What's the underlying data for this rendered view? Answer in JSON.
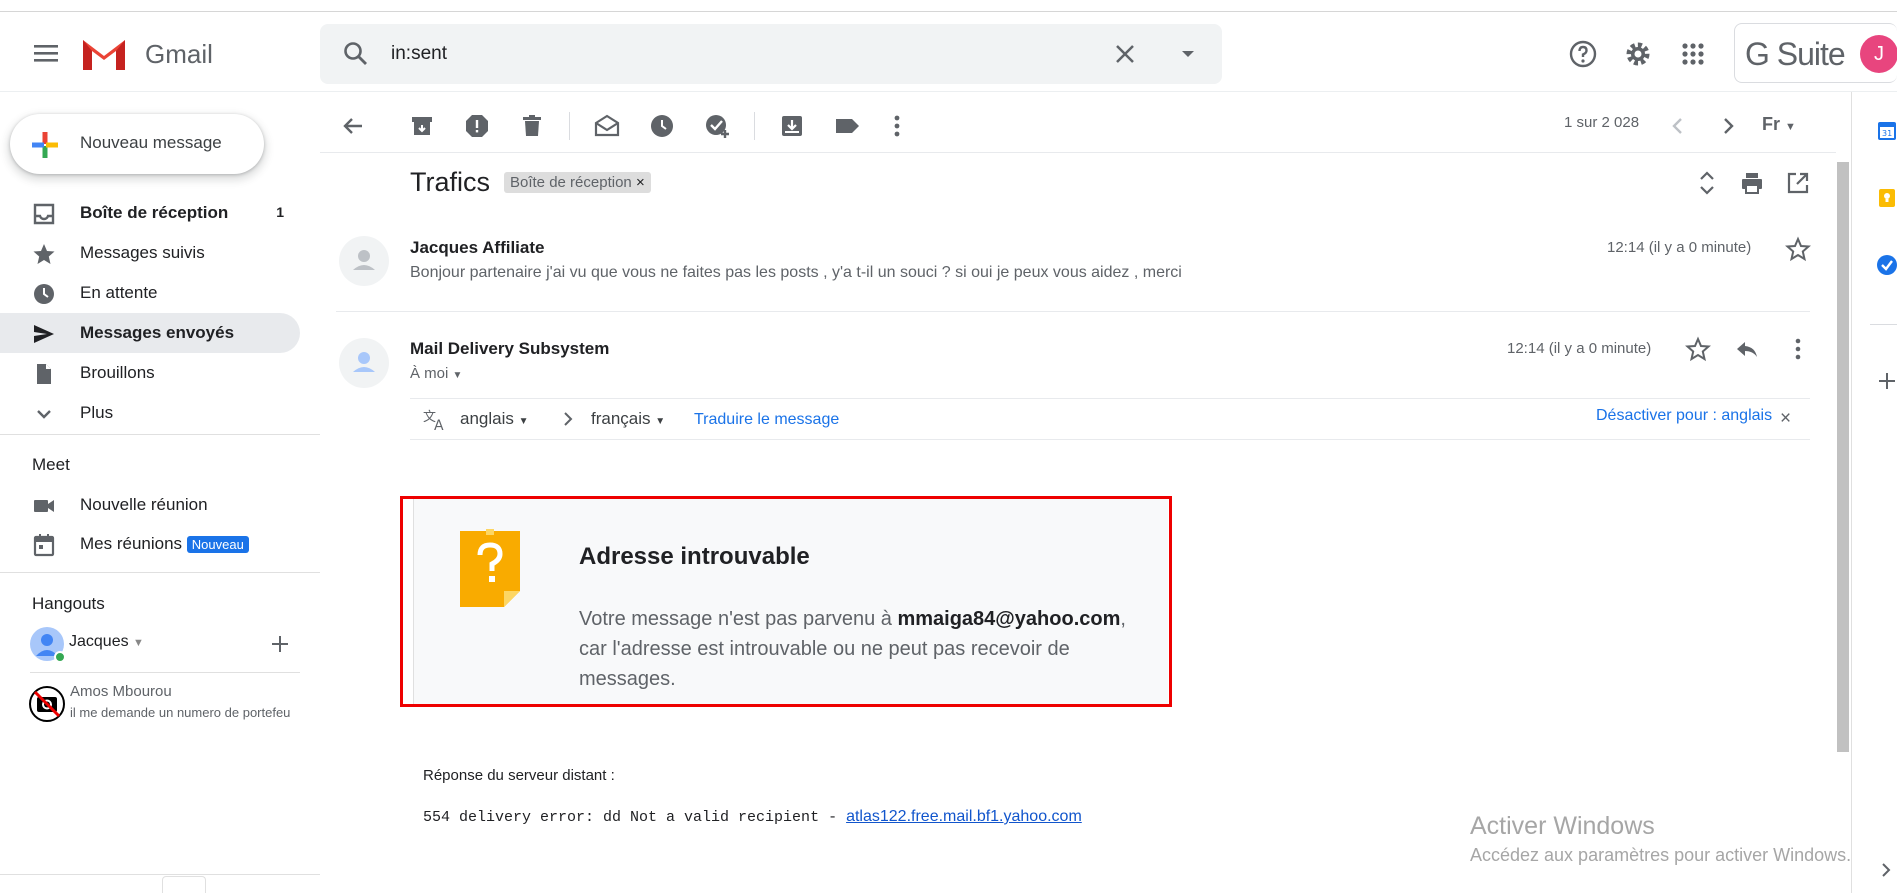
{
  "app": {
    "name": "Gmail"
  },
  "search": {
    "query": "in:sent"
  },
  "gsuite": {
    "label": "G Suite",
    "avatar_letter": "J"
  },
  "compose": {
    "label": "Nouveau message"
  },
  "nav": {
    "items": [
      {
        "label": "Boîte de réception",
        "count": "1"
      },
      {
        "label": "Messages suivis"
      },
      {
        "label": "En attente"
      },
      {
        "label": "Messages envoyés"
      },
      {
        "label": "Brouillons"
      },
      {
        "label": "Plus"
      }
    ],
    "meet": {
      "heading": "Meet",
      "items": [
        {
          "label": "Nouvelle réunion"
        },
        {
          "label": "Mes réunions",
          "badge": "Nouveau"
        }
      ]
    },
    "hangouts": {
      "heading": "Hangouts",
      "user": "Jacques",
      "contacts": [
        {
          "name": "Amos Mbourou",
          "snippet": "il me demande un numero de portefeu"
        }
      ]
    }
  },
  "toolbar": {
    "pager": "1 sur 2 028",
    "lang_short": "Fr"
  },
  "thread": {
    "subject": "Trafics",
    "label": "Boîte de réception",
    "label_remove": "×",
    "messages": [
      {
        "sender": "Jacques Affiliate",
        "time": "12:14 (il y a 0 minute)",
        "snippet": "Bonjour partenaire j'ai vu que vous ne faites pas les posts , y'a t-il un souci ? si oui je peux vous aidez , merci"
      },
      {
        "sender": "Mail Delivery Subsystem",
        "time": "12:14 (il y a 0 minute)",
        "to": "À moi"
      }
    ],
    "translate": {
      "from": "anglais",
      "to": "français",
      "action": "Traduire le message",
      "disable": "Désactiver pour : anglais",
      "close": "×"
    },
    "ndr": {
      "title": "Adresse introuvable",
      "text_before": "Votre message n'est pas parvenu à ",
      "email": "mmaiga84@yahoo.com",
      "text_after": ", car l'adresse est introuvable ou ne peut pas recevoir de messages."
    },
    "server": {
      "label": "Réponse du serveur distant :",
      "response": "554 delivery error: dd Not a valid recipient - ",
      "link": "atlas122.free.mail.bf1.yahoo.com"
    }
  },
  "watermark": {
    "line1": "Activer Windows",
    "line2": "Accédez aux paramètres pour activer Windows."
  },
  "colors": {
    "accent_blue": "#1a73e8",
    "highlight_red": "#e00000",
    "active_nav": "#e8eaed"
  }
}
